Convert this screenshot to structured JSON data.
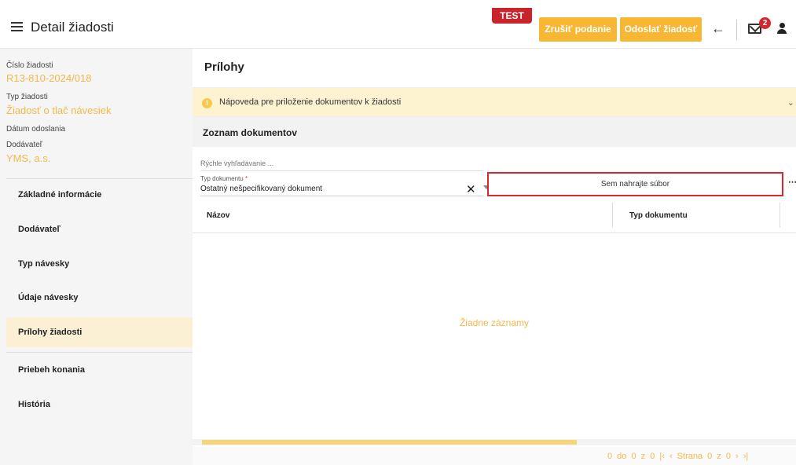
{
  "header": {
    "title": "Detail žiadosti",
    "env_badge": "TEST",
    "cancel_button": "Zrušiť podanie",
    "send_button": "Odoslať žiadosť",
    "notifications_count": "2"
  },
  "sidebar": {
    "meta": [
      {
        "label": "Číslo žiadosti",
        "value": "R13-810-2024/018"
      },
      {
        "label": "Typ žiadosti",
        "value": "Žiadosť o tlač návesiek"
      },
      {
        "label": "Dátum odoslania",
        "value": ""
      },
      {
        "label": "Dodávateľ",
        "value": "YMS, a.s."
      }
    ],
    "items": [
      {
        "label": "Základné informácie"
      },
      {
        "label": "Dodávateľ"
      },
      {
        "label": "Typ návesky"
      },
      {
        "label": "Údaje návesky"
      },
      {
        "label": "Prílohy žiadosti"
      },
      {
        "label": "Priebeh konania"
      },
      {
        "label": "História"
      }
    ],
    "active_item": "Prílohy žiadosti"
  },
  "main": {
    "title": "Prílohy",
    "help_text": "Nápoveda pre priloženie dokumentov k žiadosti",
    "list_title": "Zoznam dokumentov",
    "search_placeholder": "Rýchle vyhľadávanie ...",
    "type_field_label": "Typ dokumentu",
    "type_field_required": "*",
    "type_field_value": "Ostatný nešpecifikovaný dokument",
    "upload_button": "Sem nahrajte súbor",
    "table": {
      "columns": [
        "Názov",
        "Typ dokumentu"
      ],
      "rows": [],
      "empty_text": "Žiadne záznamy"
    },
    "pager": "0 do 0 z 0   |‹   ‹  Strana  0  z  0   ›   ›|"
  },
  "colors": {
    "accent": "#f7b733",
    "badge": "#c9242b",
    "highlight_border": "#d9262f"
  }
}
